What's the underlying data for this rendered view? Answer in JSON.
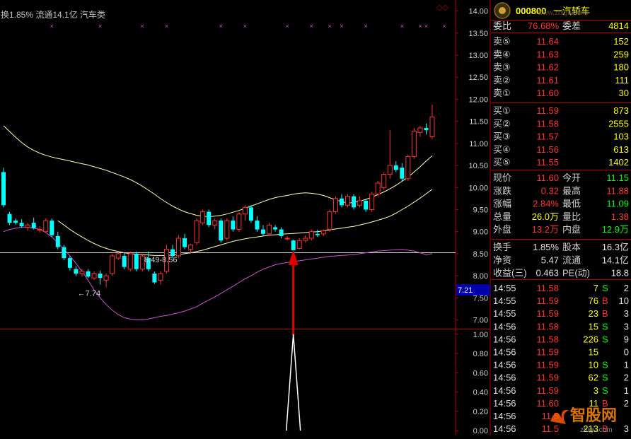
{
  "header": {
    "info_text": "换1.85% 流通14.1亿 汽车类",
    "corner_icon": "◇◇"
  },
  "quote_panel": {
    "code": "000800",
    "name": "一汽轿车",
    "wei_bi_label": "委比",
    "wei_bi": "76.68%",
    "wei_cha_label": "委差",
    "wei_cha": "4814",
    "asks": [
      {
        "label": "卖⑤",
        "price": "11.64",
        "vol": "152"
      },
      {
        "label": "卖④",
        "price": "11.63",
        "vol": "259"
      },
      {
        "label": "卖③",
        "price": "11.62",
        "vol": "180"
      },
      {
        "label": "卖②",
        "price": "11.61",
        "vol": "111"
      },
      {
        "label": "卖①",
        "price": "11.60",
        "vol": "30"
      }
    ],
    "bids": [
      {
        "label": "买①",
        "price": "11.59",
        "vol": "873"
      },
      {
        "label": "买②",
        "price": "11.58",
        "vol": "2555"
      },
      {
        "label": "买③",
        "price": "11.57",
        "vol": "103"
      },
      {
        "label": "买④",
        "price": "11.56",
        "vol": "613"
      },
      {
        "label": "买⑤",
        "price": "11.55",
        "vol": "1402"
      }
    ],
    "stats": [
      {
        "l1": "现价",
        "v1": "11.60",
        "l2": "今开",
        "v2": "11.15"
      },
      {
        "l1": "涨跌",
        "v1": "0.32",
        "l2": "最高",
        "v2": "11.88"
      },
      {
        "l1": "涨幅",
        "v1": "2.84%",
        "l2": "最低",
        "v2": "11.09"
      },
      {
        "l1": "总量",
        "v1": "26.0万",
        "l2": "量比",
        "v2": "1.38"
      },
      {
        "l1": "外盘",
        "v1": "13.2万",
        "l2": "内盘",
        "v2": "12.9万"
      }
    ],
    "stats2": [
      {
        "l1": "换手",
        "v1": "1.85%",
        "l2": "股本",
        "v2": "16.3亿"
      },
      {
        "l1": "净资",
        "v1": "5.47",
        "l2": "流通",
        "v2": "14.1亿"
      },
      {
        "l1": "收益(三)",
        "v1": "0.463",
        "l2": "PE(动)",
        "v2": "18.8"
      }
    ],
    "ticks": [
      {
        "t": "14:55",
        "p": "11.58",
        "v": "7",
        "f": "S",
        "n": "2"
      },
      {
        "t": "14:55",
        "p": "11.59",
        "v": "76",
        "f": "B",
        "n": "10"
      },
      {
        "t": "14:55",
        "p": "11.59",
        "v": "23",
        "f": "B",
        "n": "3"
      },
      {
        "t": "14:56",
        "p": "11.58",
        "v": "15",
        "f": "S",
        "n": "3"
      },
      {
        "t": "14:56",
        "p": "11.58",
        "v": "226",
        "f": "S",
        "n": "9"
      },
      {
        "t": "14:56",
        "p": "11.59",
        "v": "15",
        "f": "",
        "n": "0"
      },
      {
        "t": "14:56",
        "p": "11.59",
        "v": "10",
        "f": "S",
        "n": "1"
      },
      {
        "t": "14:56",
        "p": "11.59",
        "v": "62",
        "f": "S",
        "n": "2"
      },
      {
        "t": "14:56",
        "p": "11.59",
        "v": "3",
        "f": "S",
        "n": "1"
      },
      {
        "t": "14:56",
        "p": "11.60",
        "v": "11",
        "f": "B",
        "n": "2"
      },
      {
        "t": "14:56",
        "p": "11.5",
        "v": "",
        "f": "",
        "n": ""
      },
      {
        "t": "14:56",
        "p": "11.5",
        "v": "213",
        "f": "B",
        "n": "3"
      }
    ]
  },
  "watermark": {
    "main": "智股网",
    "sub": "zhigu.com",
    "mid": "www.zhigu.com"
  },
  "colors": {
    "up": "#ff3232",
    "down": "#00ffff",
    "white": "#ffffff",
    "yellow": "#ffff00",
    "green": "#00ff00",
    "magenta": "#d050d0",
    "mauve": "#ffffb0"
  },
  "chart_data": {
    "type": "candlestick",
    "main_axis": {
      "ticks": [
        "14.00",
        "13.50",
        "13.00",
        "12.50",
        "12.00",
        "11.50",
        "11.00",
        "10.50",
        "10.00",
        "9.50",
        "9.00",
        "8.50",
        "8.00",
        "7.50",
        "7.00"
      ],
      "ylim": [
        6.8,
        14.25
      ]
    },
    "sub_axis": {
      "ticks": [
        "1.00",
        "0.80",
        "0.60",
        "0.40",
        "0.20",
        "0.00"
      ],
      "ylim": [
        -0.05,
        1.05
      ]
    },
    "current_price_tag": "7.21",
    "annotations": {
      "low_label": "←7.74",
      "range_label": "8.49-8.56"
    },
    "candles": [
      {
        "o": 10.35,
        "h": 10.45,
        "l": 9.55,
        "c": 9.6
      },
      {
        "o": 9.4,
        "h": 9.45,
        "l": 9.15,
        "c": 9.2
      },
      {
        "o": 9.25,
        "h": 9.3,
        "l": 9.15,
        "c": 9.2
      },
      {
        "o": 9.2,
        "h": 9.28,
        "l": 9.1,
        "c": 9.12
      },
      {
        "o": 9.1,
        "h": 9.2,
        "l": 9.02,
        "c": 9.15
      },
      {
        "o": 9.2,
        "h": 9.32,
        "l": 9.05,
        "c": 9.08
      },
      {
        "o": 9.05,
        "h": 9.12,
        "l": 8.98,
        "c": 9.05
      },
      {
        "o": 9.0,
        "h": 9.3,
        "l": 8.98,
        "c": 9.25
      },
      {
        "o": 9.25,
        "h": 9.3,
        "l": 8.88,
        "c": 8.92
      },
      {
        "o": 8.9,
        "h": 9.0,
        "l": 8.6,
        "c": 8.65
      },
      {
        "o": 8.65,
        "h": 8.7,
        "l": 8.35,
        "c": 8.4
      },
      {
        "o": 8.4,
        "h": 8.45,
        "l": 8.12,
        "c": 8.18
      },
      {
        "o": 8.15,
        "h": 8.22,
        "l": 8.0,
        "c": 8.05
      },
      {
        "o": 8.05,
        "h": 8.15,
        "l": 7.98,
        "c": 8.1
      },
      {
        "o": 8.1,
        "h": 8.15,
        "l": 7.95,
        "c": 7.98
      },
      {
        "o": 7.95,
        "h": 8.1,
        "l": 7.9,
        "c": 8.05
      },
      {
        "o": 8.05,
        "h": 8.12,
        "l": 7.8,
        "c": 7.95
      },
      {
        "o": 7.9,
        "h": 8.05,
        "l": 7.74,
        "c": 8.0
      },
      {
        "o": 8.05,
        "h": 8.5,
        "l": 8.0,
        "c": 8.45
      },
      {
        "o": 8.4,
        "h": 8.55,
        "l": 8.35,
        "c": 8.5
      },
      {
        "o": 8.45,
        "h": 8.52,
        "l": 8.15,
        "c": 8.2
      },
      {
        "o": 8.15,
        "h": 8.55,
        "l": 8.1,
        "c": 8.5
      },
      {
        "o": 8.5,
        "h": 8.55,
        "l": 8.1,
        "c": 8.15
      },
      {
        "o": 8.15,
        "h": 8.5,
        "l": 8.1,
        "c": 8.45
      },
      {
        "o": 8.4,
        "h": 8.55,
        "l": 8.1,
        "c": 8.15
      },
      {
        "o": 8.05,
        "h": 8.1,
        "l": 7.82,
        "c": 7.85
      },
      {
        "o": 7.9,
        "h": 8.1,
        "l": 7.8,
        "c": 8.05
      },
      {
        "o": 8.1,
        "h": 8.7,
        "l": 8.05,
        "c": 8.6
      },
      {
        "o": 8.6,
        "h": 8.7,
        "l": 8.4,
        "c": 8.45
      },
      {
        "o": 8.45,
        "h": 8.92,
        "l": 8.4,
        "c": 8.85
      },
      {
        "o": 8.85,
        "h": 8.95,
        "l": 8.6,
        "c": 8.65
      },
      {
        "o": 8.6,
        "h": 8.72,
        "l": 8.5,
        "c": 8.7
      },
      {
        "o": 8.75,
        "h": 9.3,
        "l": 8.7,
        "c": 9.25
      },
      {
        "o": 9.2,
        "h": 9.5,
        "l": 9.15,
        "c": 9.45
      },
      {
        "o": 9.45,
        "h": 9.5,
        "l": 9.1,
        "c": 9.15
      },
      {
        "o": 9.15,
        "h": 9.3,
        "l": 9.05,
        "c": 9.25
      },
      {
        "o": 9.25,
        "h": 9.3,
        "l": 8.75,
        "c": 8.8
      },
      {
        "o": 8.85,
        "h": 9.3,
        "l": 8.8,
        "c": 9.25
      },
      {
        "o": 9.25,
        "h": 9.35,
        "l": 9.0,
        "c": 9.05
      },
      {
        "o": 9.05,
        "h": 9.45,
        "l": 9.0,
        "c": 9.4
      },
      {
        "o": 9.4,
        "h": 9.6,
        "l": 9.25,
        "c": 9.55
      },
      {
        "o": 9.55,
        "h": 9.6,
        "l": 9.2,
        "c": 9.25
      },
      {
        "o": 9.25,
        "h": 9.35,
        "l": 9.0,
        "c": 9.05
      },
      {
        "o": 9.05,
        "h": 9.15,
        "l": 8.9,
        "c": 8.95
      },
      {
        "o": 8.95,
        "h": 9.2,
        "l": 8.9,
        "c": 9.15
      },
      {
        "o": 9.1,
        "h": 9.15,
        "l": 9.0,
        "c": 9.05
      },
      {
        "o": 9.05,
        "h": 9.1,
        "l": 8.85,
        "c": 8.9
      },
      {
        "o": 8.85,
        "h": 8.9,
        "l": 8.8,
        "c": 8.85
      },
      {
        "o": 8.8,
        "h": 8.82,
        "l": 8.55,
        "c": 8.58
      },
      {
        "o": 8.62,
        "h": 8.85,
        "l": 8.6,
        "c": 8.8
      },
      {
        "o": 8.8,
        "h": 8.92,
        "l": 8.75,
        "c": 8.85
      },
      {
        "o": 8.85,
        "h": 9.05,
        "l": 8.8,
        "c": 9.0
      },
      {
        "o": 8.95,
        "h": 9.05,
        "l": 8.88,
        "c": 8.92
      },
      {
        "o": 8.95,
        "h": 9.05,
        "l": 8.9,
        "c": 9.02
      },
      {
        "o": 9.05,
        "h": 9.5,
        "l": 9.0,
        "c": 9.45
      },
      {
        "o": 9.45,
        "h": 9.8,
        "l": 9.4,
        "c": 9.75
      },
      {
        "o": 9.75,
        "h": 9.85,
        "l": 9.55,
        "c": 9.6
      },
      {
        "o": 9.6,
        "h": 9.85,
        "l": 9.55,
        "c": 9.8
      },
      {
        "o": 9.8,
        "h": 9.85,
        "l": 9.5,
        "c": 9.55
      },
      {
        "o": 9.6,
        "h": 9.8,
        "l": 9.55,
        "c": 9.7
      },
      {
        "o": 9.7,
        "h": 9.75,
        "l": 9.45,
        "c": 9.5
      },
      {
        "o": 9.5,
        "h": 9.9,
        "l": 9.45,
        "c": 9.85
      },
      {
        "o": 9.85,
        "h": 10.15,
        "l": 9.8,
        "c": 10.1
      },
      {
        "o": 10.0,
        "h": 10.35,
        "l": 9.95,
        "c": 10.3
      },
      {
        "o": 10.3,
        "h": 11.3,
        "l": 10.2,
        "c": 10.5
      },
      {
        "o": 10.5,
        "h": 10.6,
        "l": 10.35,
        "c": 10.4
      },
      {
        "o": 10.45,
        "h": 10.55,
        "l": 10.15,
        "c": 10.2
      },
      {
        "o": 10.2,
        "h": 10.75,
        "l": 10.15,
        "c": 10.7
      },
      {
        "o": 10.7,
        "h": 11.35,
        "l": 10.65,
        "c": 11.28
      },
      {
        "o": 11.25,
        "h": 11.4,
        "l": 11.15,
        "c": 11.35
      },
      {
        "o": 11.35,
        "h": 11.45,
        "l": 11.2,
        "c": 11.3
      },
      {
        "o": 11.15,
        "h": 11.88,
        "l": 11.09,
        "c": 11.6
      }
    ],
    "series": [
      {
        "values": [
          11.4,
          11.27,
          11.14,
          11.02,
          10.92,
          10.84,
          10.78,
          10.73,
          10.69,
          10.66,
          10.63,
          10.6,
          10.57,
          10.54,
          10.51,
          10.47,
          10.43,
          10.39,
          10.34,
          10.29,
          10.24,
          10.18,
          10.11,
          10.03,
          9.94,
          9.85,
          9.75,
          9.66,
          9.58,
          9.51,
          9.45,
          9.41,
          9.37,
          9.35,
          9.34,
          9.35,
          9.37,
          9.4,
          9.44,
          9.48,
          9.53,
          9.58,
          9.63,
          9.68,
          9.73,
          9.77,
          9.8,
          9.82,
          9.85,
          9.87,
          9.88,
          9.87,
          9.85,
          9.82,
          9.77,
          9.72,
          9.68,
          9.65,
          9.66,
          9.69,
          9.73,
          9.78,
          9.84,
          9.9,
          9.97,
          10.05,
          10.14,
          10.24,
          10.35,
          10.47,
          10.6,
          10.72
        ]
      },
      {
        "values": [
          null,
          null,
          null,
          null,
          null,
          null,
          null,
          null,
          null,
          9.25,
          9.15,
          9.05,
          8.96,
          8.88,
          8.8,
          8.73,
          8.67,
          8.62,
          8.58,
          8.55,
          8.52,
          8.5,
          8.49,
          8.48,
          8.47,
          8.46,
          8.46,
          8.46,
          8.47,
          8.48,
          8.5,
          8.52,
          8.55,
          8.58,
          8.62,
          8.66,
          8.7,
          8.74,
          8.78,
          8.81,
          8.84,
          8.86,
          8.88,
          8.9,
          8.92,
          8.93,
          8.94,
          8.95,
          8.96,
          8.97,
          8.98,
          8.99,
          9.0,
          9.02,
          9.04,
          9.06,
          9.08,
          9.1,
          9.12,
          9.15,
          9.18,
          9.22,
          9.26,
          9.3,
          9.35,
          9.42,
          9.5,
          9.58,
          9.67,
          9.76,
          9.86,
          9.96
        ]
      },
      {
        "values": [
          9.0,
          9.05,
          9.08,
          9.1,
          9.1,
          9.08,
          9.05,
          8.98,
          8.88,
          8.75,
          8.6,
          8.45,
          8.28,
          8.1,
          7.9,
          7.68,
          7.5,
          7.35,
          7.22,
          7.12,
          7.05,
          7.02,
          7.0,
          7.0,
          7.02,
          7.05,
          7.08,
          7.1,
          7.13,
          7.16,
          7.2,
          7.25,
          7.3,
          7.38,
          7.45,
          7.52,
          7.6,
          7.68,
          7.76,
          7.85,
          7.93,
          8.0,
          8.08,
          8.15,
          8.2,
          8.25,
          8.28,
          8.3,
          8.32,
          8.34,
          8.36,
          8.38,
          8.4,
          8.42,
          8.44,
          8.45,
          8.46,
          8.47,
          8.48,
          8.5,
          8.52,
          8.54,
          8.56,
          8.57,
          8.58,
          8.59,
          8.6,
          8.58,
          8.56,
          8.52,
          8.48,
          8.5
        ]
      }
    ],
    "support_level": 8.53,
    "signal_index": 48,
    "signal_value": 1.0,
    "x_marks": [
      8,
      16,
      23,
      27,
      36,
      40,
      47,
      51,
      54,
      56,
      60,
      66,
      69,
      70,
      73
    ]
  }
}
